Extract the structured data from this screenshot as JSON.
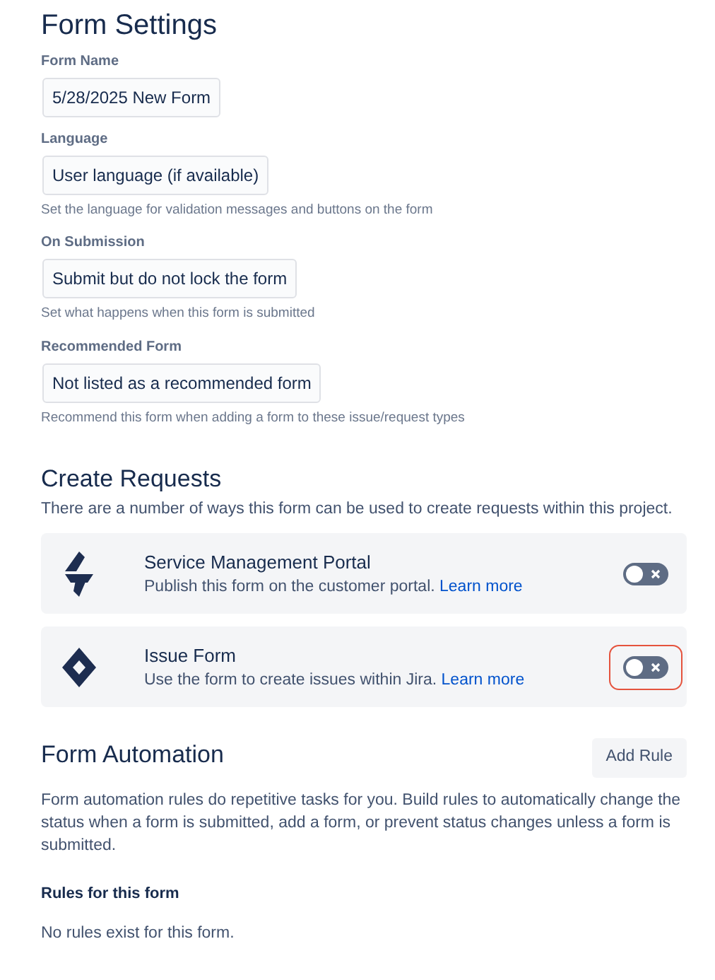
{
  "title": "Form Settings",
  "fields": [
    {
      "label": "Form Name",
      "value": "5/28/2025 New Form"
    },
    {
      "label": "Language",
      "value": "User language (if available)",
      "help": "Set the language for validation messages and buttons on the form"
    },
    {
      "label": "On Submission",
      "value": "Submit but do not lock the form",
      "help": "Set what happens when this form is submitted"
    },
    {
      "label": "Recommended Form",
      "value": "Not listed as a recommended form",
      "help": "Recommend this form when adding a form to these issue/request types"
    }
  ],
  "create_requests": {
    "title": "Create Requests",
    "description": "There are a number of ways this form can be used to create requests within this project.",
    "options": [
      {
        "kind": "portal",
        "title": "Service Management Portal",
        "description": "Publish this form on the customer portal.",
        "link": "Learn more",
        "on": false,
        "highlighted": false
      },
      {
        "kind": "issue",
        "title": "Issue Form",
        "description": "Use the form to create issues within Jira.",
        "link": "Learn more",
        "on": false,
        "highlighted": true
      }
    ]
  },
  "automation": {
    "title": "Form Automation",
    "button": "Add Rule",
    "description": "Form automation rules do repetitive tasks for you. Build rules to automatically change the status when a form is submitted, add a form, or prevent status changes unless a form is submitted.",
    "rules_title": "Rules for this form",
    "empty": "No rules exist for this form."
  }
}
